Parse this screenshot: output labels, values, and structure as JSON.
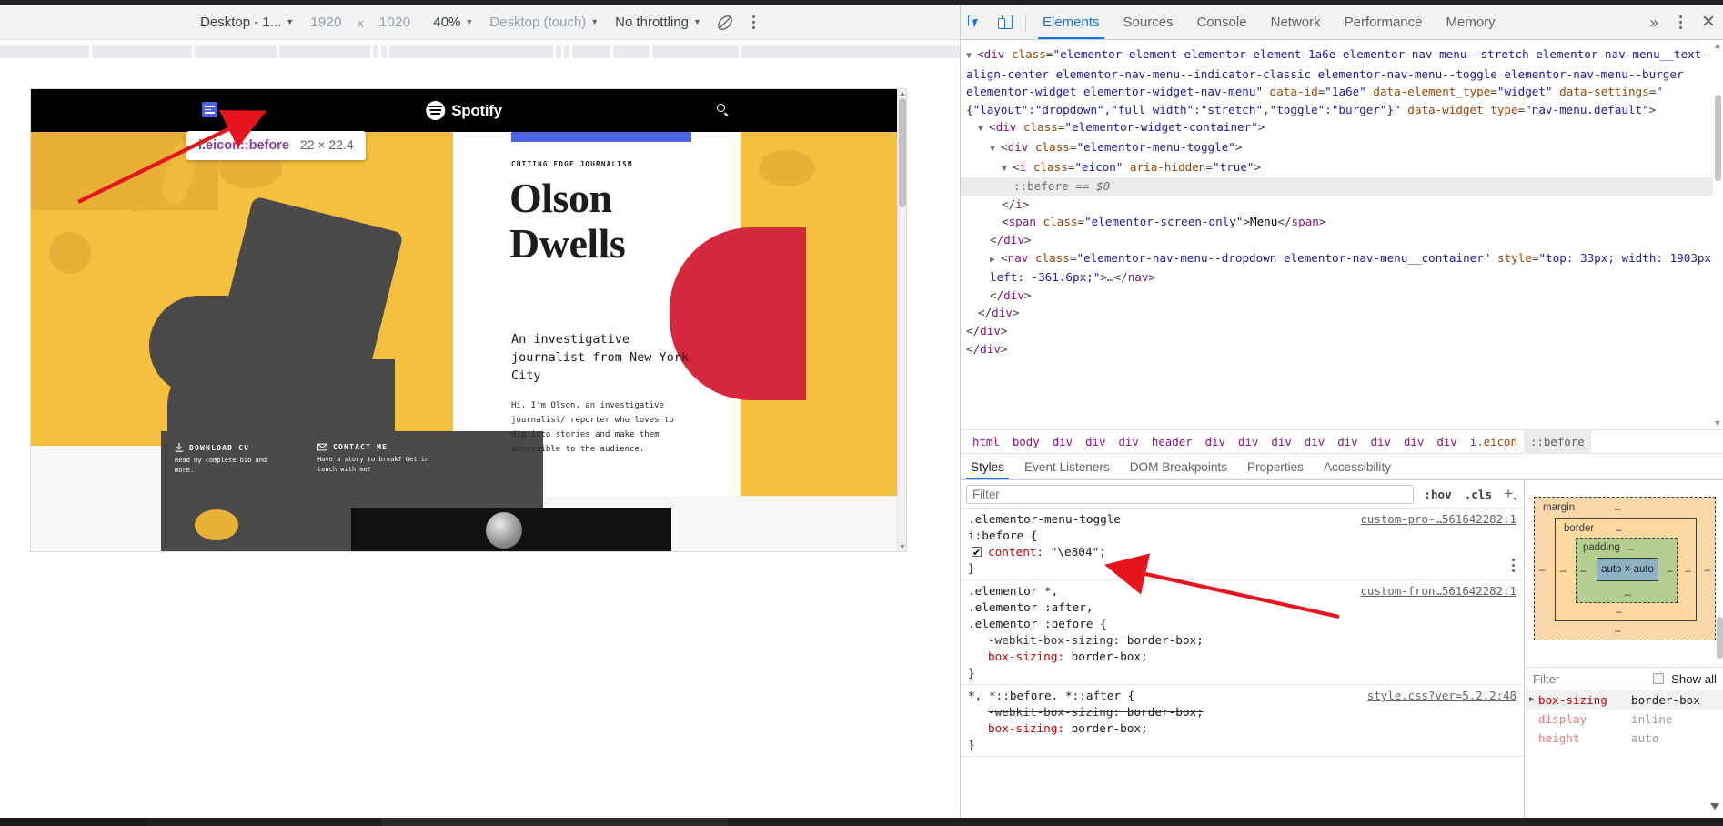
{
  "device_toolbar": {
    "device_label": "Desktop - 1...",
    "width": "1920",
    "times": "x",
    "height": "1020",
    "zoom": "40%",
    "user_agent": "Desktop (touch)",
    "throttling": "No throttling",
    "rotate_icon": "rotate-device-icon",
    "more_icon": "more-options-icon"
  },
  "devtools": {
    "inspect_icon": "inspect-element-icon",
    "device_toggle_icon": "device-toolbar-icon",
    "tabs": [
      {
        "label": "Elements",
        "active": true
      },
      {
        "label": "Sources",
        "active": false
      },
      {
        "label": "Console",
        "active": false
      },
      {
        "label": "Network",
        "active": false
      },
      {
        "label": "Performance",
        "active": false
      },
      {
        "label": "Memory",
        "active": false
      }
    ],
    "more_tabs_label": "»",
    "settings_icon": "kebab-menu-icon",
    "close_label": "✕"
  },
  "dom_tree": {
    "lines": [
      {
        "indent": 0,
        "triangle": "▼",
        "segments": [
          {
            "t": "<",
            "c": "punc"
          },
          {
            "t": "div",
            "c": "tag"
          },
          {
            "t": " class",
            "c": "attr"
          },
          {
            "t": "=",
            "c": "punc"
          },
          {
            "t": "\"elementor-element elementor-element-1a6e elementor-nav-menu--stretch elementor-nav-menu__text-align-center elementor-nav-menu--indicator-classic elementor-nav-menu--toggle elementor-nav-menu--burger elementor-widget elementor-widget-nav-menu\"",
            "c": "val"
          },
          {
            "t": " data-id",
            "c": "attr"
          },
          {
            "t": "=",
            "c": "punc"
          },
          {
            "t": "\"1a6e\"",
            "c": "val"
          },
          {
            "t": " data-element_type",
            "c": "attr"
          },
          {
            "t": "=",
            "c": "punc"
          },
          {
            "t": "\"widget\"",
            "c": "val"
          },
          {
            "t": " data-settings",
            "c": "attr"
          },
          {
            "t": "=",
            "c": "punc"
          },
          {
            "t": "\"{\"layout\":\"dropdown\",\"full_width\":\"stretch\",\"toggle\":\"burger\"}\"",
            "c": "val"
          },
          {
            "t": " data-widget_type",
            "c": "attr"
          },
          {
            "t": "=",
            "c": "punc"
          },
          {
            "t": "\"nav-menu.default\"",
            "c": "val"
          },
          {
            "t": ">",
            "c": "punc"
          }
        ]
      },
      {
        "indent": 1,
        "triangle": "▼",
        "segments": [
          {
            "t": "<",
            "c": "punc"
          },
          {
            "t": "div",
            "c": "tag"
          },
          {
            "t": " class",
            "c": "attr"
          },
          {
            "t": "=",
            "c": "punc"
          },
          {
            "t": "\"elementor-widget-container\"",
            "c": "val"
          },
          {
            "t": ">",
            "c": "punc"
          }
        ]
      },
      {
        "indent": 2,
        "triangle": "▼",
        "segments": [
          {
            "t": "<",
            "c": "punc"
          },
          {
            "t": "div",
            "c": "tag"
          },
          {
            "t": " class",
            "c": "attr"
          },
          {
            "t": "=",
            "c": "punc"
          },
          {
            "t": "\"elementor-menu-toggle\"",
            "c": "val"
          },
          {
            "t": ">",
            "c": "punc"
          }
        ]
      },
      {
        "indent": 3,
        "triangle": "▼",
        "segments": [
          {
            "t": "<",
            "c": "punc"
          },
          {
            "t": "i",
            "c": "tag"
          },
          {
            "t": " class",
            "c": "attr"
          },
          {
            "t": "=",
            "c": "punc"
          },
          {
            "t": "\"eicon\"",
            "c": "val"
          },
          {
            "t": " aria-hidden",
            "c": "attr"
          },
          {
            "t": "=",
            "c": "punc"
          },
          {
            "t": "\"true\"",
            "c": "val"
          },
          {
            "t": ">",
            "c": "punc"
          }
        ]
      },
      {
        "indent": 4,
        "selected": true,
        "segments": [
          {
            "t": "::before",
            "c": "pseudo"
          },
          {
            "t": " == ",
            "c": "pseudo"
          },
          {
            "t": "$0",
            "c": "gray-i"
          }
        ]
      },
      {
        "indent": 3,
        "segments": [
          {
            "t": "</",
            "c": "punc"
          },
          {
            "t": "i",
            "c": "tag"
          },
          {
            "t": ">",
            "c": "punc"
          }
        ]
      },
      {
        "indent": 3,
        "segments": [
          {
            "t": "<",
            "c": "punc"
          },
          {
            "t": "span",
            "c": "tag"
          },
          {
            "t": " class",
            "c": "attr"
          },
          {
            "t": "=",
            "c": "punc"
          },
          {
            "t": "\"elementor-screen-only\"",
            "c": "val"
          },
          {
            "t": ">",
            "c": "punc"
          },
          {
            "t": "Menu",
            "c": "txt"
          },
          {
            "t": "</",
            "c": "punc"
          },
          {
            "t": "span",
            "c": "tag"
          },
          {
            "t": ">",
            "c": "punc"
          }
        ]
      },
      {
        "indent": 2,
        "segments": [
          {
            "t": "</",
            "c": "punc"
          },
          {
            "t": "div",
            "c": "tag"
          },
          {
            "t": ">",
            "c": "punc"
          }
        ]
      },
      {
        "indent": 2,
        "triangle": "▶",
        "segments": [
          {
            "t": "<",
            "c": "punc"
          },
          {
            "t": "nav",
            "c": "tag"
          },
          {
            "t": " class",
            "c": "attr"
          },
          {
            "t": "=",
            "c": "punc"
          },
          {
            "t": "\"elementor-nav-menu--dropdown elementor-nav-menu__container\"",
            "c": "val"
          },
          {
            "t": " style",
            "c": "attr"
          },
          {
            "t": "=",
            "c": "punc"
          },
          {
            "t": "\"top: 33px; width: 1903px; left: -361.6px;\"",
            "c": "val"
          },
          {
            "t": ">",
            "c": "punc"
          },
          {
            "t": "…",
            "c": "punc"
          },
          {
            "t": "</",
            "c": "punc"
          },
          {
            "t": "nav",
            "c": "tag"
          },
          {
            "t": ">",
            "c": "punc"
          }
        ]
      },
      {
        "indent": 2,
        "segments": [
          {
            "t": "</",
            "c": "punc"
          },
          {
            "t": "div",
            "c": "tag"
          },
          {
            "t": ">",
            "c": "punc"
          }
        ]
      },
      {
        "indent": 1,
        "segments": [
          {
            "t": "</",
            "c": "punc"
          },
          {
            "t": "div",
            "c": "tag"
          },
          {
            "t": ">",
            "c": "punc"
          }
        ]
      },
      {
        "indent": 0,
        "segments": [
          {
            "t": "</",
            "c": "punc"
          },
          {
            "t": "div",
            "c": "tag"
          },
          {
            "t": ">",
            "c": "punc"
          }
        ]
      },
      {
        "indent": 0,
        "segments": [
          {
            "t": "</",
            "c": "punc"
          },
          {
            "t": "div",
            "c": "tag"
          },
          {
            "t": ">",
            "c": "punc"
          }
        ]
      }
    ]
  },
  "breadcrumb": [
    {
      "label": "html",
      "active": false
    },
    {
      "label": "body",
      "active": false
    },
    {
      "label": "div",
      "active": false
    },
    {
      "label": "div",
      "active": false
    },
    {
      "label": "div",
      "active": false
    },
    {
      "label": "header",
      "active": false
    },
    {
      "label": "div",
      "active": false
    },
    {
      "label": "div",
      "active": false
    },
    {
      "label": "div",
      "active": false
    },
    {
      "label": "div",
      "active": false
    },
    {
      "label": "div",
      "active": false
    },
    {
      "label": "div",
      "active": false
    },
    {
      "label": "div",
      "active": false
    },
    {
      "label": "div",
      "active": false
    },
    {
      "label": "i.eicon",
      "active": false
    },
    {
      "label": "::before",
      "active": true
    }
  ],
  "sidebar_tabs": [
    {
      "label": "Styles",
      "active": true
    },
    {
      "label": "Event Listeners",
      "active": false
    },
    {
      "label": "DOM Breakpoints",
      "active": false
    },
    {
      "label": "Properties",
      "active": false
    },
    {
      "label": "Accessibility",
      "active": false
    }
  ],
  "styles": {
    "filter_placeholder": "Filter",
    "hov_label": ":hov",
    "cls_label": ".cls",
    "plus_label": "+",
    "rules": [
      {
        "selector": ".elementor-menu-toggle\ni:before {",
        "origin": "custom-pro-…561642282:1",
        "declarations": [
          {
            "name": "content",
            "value": "\"\\e804\";",
            "checkbox": true,
            "strike": false
          }
        ],
        "closing": "}",
        "kebab": true
      },
      {
        "selector": ".elementor *,\n.elementor :after,\n.elementor :before {",
        "origin": "custom-fron…561642282:1",
        "declarations": [
          {
            "name": "-webkit-box-sizing",
            "value": "border-box;",
            "checkbox": false,
            "strike": true
          },
          {
            "name": "box-sizing",
            "value": "border-box;",
            "checkbox": false,
            "strike": false
          }
        ],
        "closing": "}",
        "kebab": false
      },
      {
        "selector": "*, *::before, *::after {",
        "origin": "style.css?ver=5.2.2:48",
        "declarations": [
          {
            "name": "-webkit-box-sizing",
            "value": "border-box;",
            "checkbox": false,
            "strike": true
          },
          {
            "name": "box-sizing",
            "value": "border-box;",
            "checkbox": false,
            "strike": false
          }
        ],
        "closing": "}",
        "kebab": false
      }
    ]
  },
  "box_model": {
    "margin_label": "margin",
    "border_label": "border",
    "padding_label": "padding",
    "content_label": "auto × auto",
    "dash": "–"
  },
  "computed": {
    "filter_placeholder": "Filter",
    "show_all_label": "Show all",
    "rows": [
      {
        "property": "box-sizing",
        "value": "border-box",
        "expandable": true,
        "highlight": true
      },
      {
        "property": "display",
        "value": "inline",
        "expandable": false,
        "highlight": false
      },
      {
        "property": "height",
        "value": "auto",
        "expandable": false,
        "highlight": false
      }
    ]
  },
  "page_preview": {
    "brand": "Spotify",
    "menu_icon": "hamburger-menu-icon",
    "search_icon": "search-icon",
    "eyebrow": "CUTTING EDGE JOURNALISM",
    "headline_line1": "Olson",
    "headline_line2": "Dwells",
    "subhead": "An investigative journalist from New York City",
    "body": "Hi, I'm Olson, an investigative journalist/ reporter who loves to dig into stories and make them accessible to the audience.",
    "cards": [
      {
        "icon": "download-icon",
        "title": "DOWNLOAD CV",
        "desc": "Read my complete bio and more."
      },
      {
        "icon": "envelope-icon",
        "title": "CONTACT ME",
        "desc": "Have a story to break? Get in touch with me!"
      }
    ]
  },
  "inspect_badge": {
    "selector_tag": "i",
    "selector_class": ".eicon::before",
    "dimensions": "22 × 22.4"
  }
}
